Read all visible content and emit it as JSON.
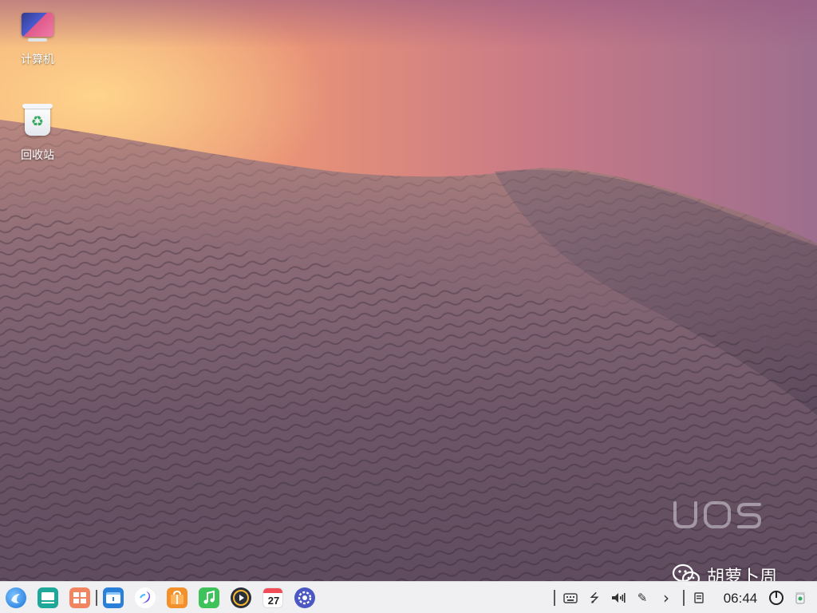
{
  "desktop": {
    "icons": [
      {
        "label": "计算机",
        "icon": "computer-icon"
      },
      {
        "label": "回收站",
        "icon": "trash-icon"
      }
    ],
    "watermark_brand": "UOS",
    "wechat_watermark": "胡萝卜周"
  },
  "taskbar": {
    "apps": [
      {
        "name": "launcher",
        "icon": "launcher-icon"
      },
      {
        "name": "multitasking-view",
        "icon": "multitask-icon"
      },
      {
        "name": "show-desktop",
        "icon": "show-desktop-icon"
      },
      {
        "name": "file-manager",
        "icon": "file-manager-icon"
      },
      {
        "name": "browser",
        "icon": "browser-icon"
      },
      {
        "name": "app-store",
        "icon": "app-store-icon"
      },
      {
        "name": "music",
        "icon": "music-icon"
      },
      {
        "name": "video-player",
        "icon": "video-icon"
      },
      {
        "name": "calendar",
        "icon": "calendar-icon",
        "day": "27"
      },
      {
        "name": "control-center",
        "icon": "settings-icon"
      }
    ],
    "tray": [
      {
        "name": "onboard-keyboard",
        "icon": "keyboard-icon"
      },
      {
        "name": "usb",
        "icon": "usb-icon",
        "glyph": "⭍"
      },
      {
        "name": "volume",
        "icon": "volume-icon",
        "glyph": "◀"
      },
      {
        "name": "pen",
        "icon": "pen-icon",
        "glyph": "✎"
      },
      {
        "name": "expand-tray",
        "icon": "chevron-right-icon",
        "glyph": "›"
      },
      {
        "name": "notification",
        "icon": "notification-icon"
      },
      {
        "name": "power",
        "icon": "shutdown-icon"
      },
      {
        "name": "trash-tray",
        "icon": "trash-small-icon"
      }
    ],
    "clock": "06:44"
  },
  "colors": {
    "taskbar_bg": "#f5f5f7",
    "launcher_blue": "#1a73d9",
    "multitask_teal": "#1fa79a",
    "show_desktop_orange": "#f08560",
    "file_manager_blue": "#2a7fd8",
    "app_store_orange": "#f2902c",
    "music_green": "#3ec25a",
    "video_dark": "#2b2f38",
    "calendar_red": "#ef4c57",
    "settings_blue": "#4b57c2"
  }
}
